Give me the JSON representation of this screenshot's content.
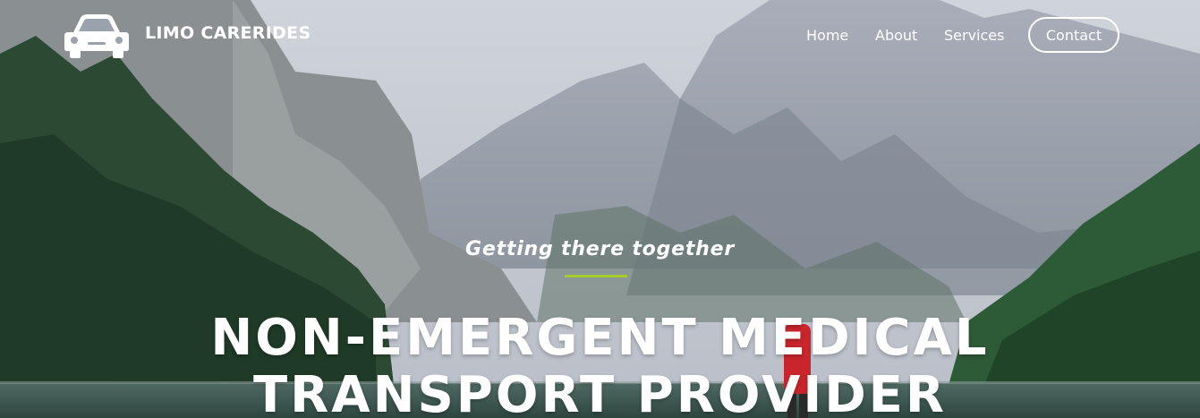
{
  "brand": {
    "name": "LIMO CARERIDES",
    "logo_icon": "car-icon"
  },
  "nav": {
    "items": [
      {
        "label": "Home"
      },
      {
        "label": "About"
      },
      {
        "label": "Services"
      }
    ],
    "contact_label": "Contact"
  },
  "hero": {
    "tagline": "Getting there together",
    "headline_line1": "NON-EMERGENT MEDICAL",
    "headline_line2": "TRANSPORT PROVIDER"
  },
  "colors": {
    "accent": "#a3cc2a",
    "text": "#ffffff"
  }
}
